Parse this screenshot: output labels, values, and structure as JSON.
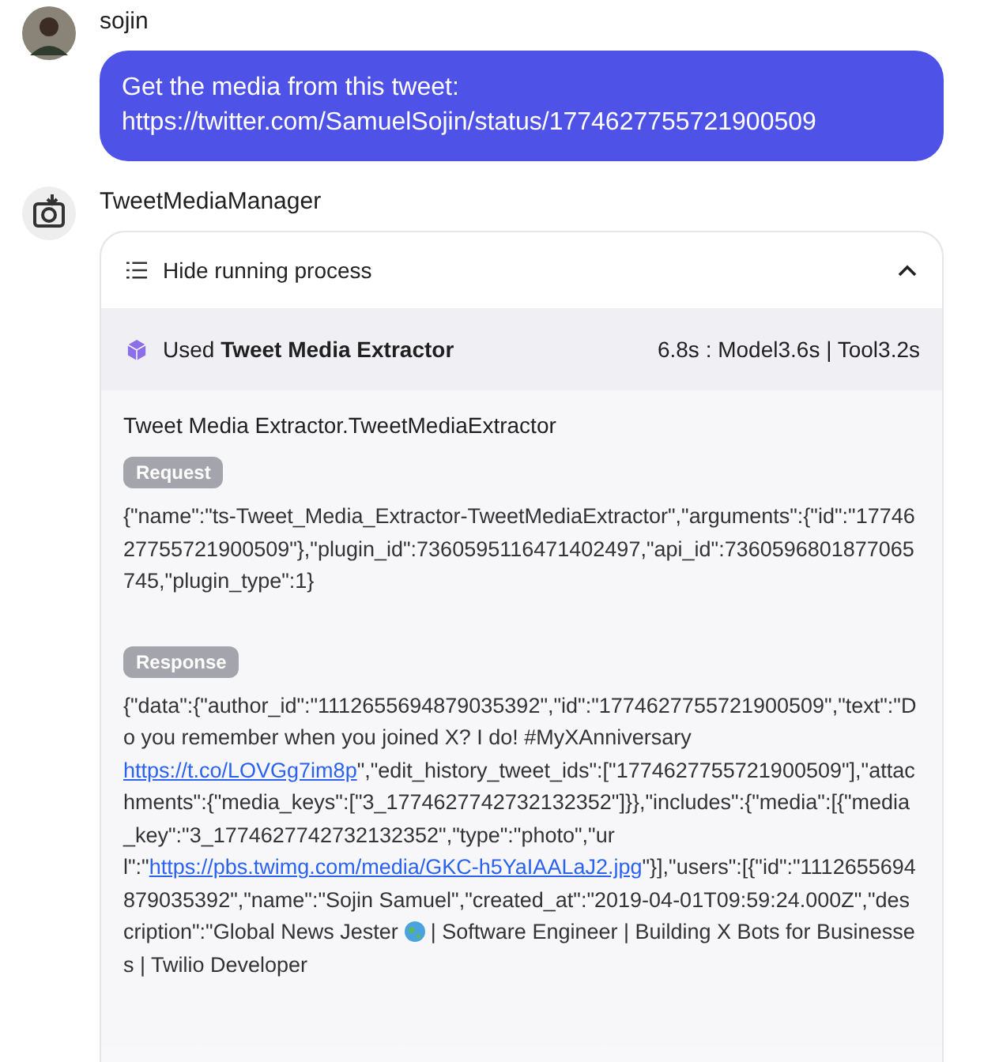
{
  "messages": [
    {
      "kind": "user",
      "sender": "sojin",
      "text": "Get the media from this tweet:\nhttps://twitter.com/SamuelSojin/status/1774627755721900509"
    },
    {
      "kind": "bot",
      "sender": "TweetMediaManager",
      "process": {
        "toggle_label": "Hide running process",
        "expanded": true,
        "used_prefix": "Used",
        "tool_name": "Tweet Media Extractor",
        "timing": "6.8s : Model3.6s | Tool3.2s",
        "call_name": "Tweet Media Extractor.TweetMediaExtractor",
        "request_label": "Request",
        "request": "{\"name\":\"ts-Tweet_Media_Extractor-TweetMediaExtractor\",\"arguments\":{\"id\":\"1774627755721900509\"},\"plugin_id\":7360595116471402497,\"api_id\":7360596801877065745,\"plugin_type\":1}",
        "response_label": "Response",
        "response": [
          {
            "kind": "text",
            "text": "{\"data\":{\"author_id\":\"1112655694879035392\",\"id\":\"1774627755721900509\",\"text\":\"Do you remember when you joined X? I do! #MyXAnniversary "
          },
          {
            "kind": "link",
            "text": "https://t.co/LOVGg7im8p"
          },
          {
            "kind": "text",
            "text": "\",\"edit_history_tweet_ids\":[\"1774627755721900509\"],\"attachments\":{\"media_keys\":[\"3_1774627742732132352\"]}},\"includes\":{\"media\":[{\"media_key\":\"3_1774627742732132352\",\"type\":\"photo\",\"url\":\""
          },
          {
            "kind": "link",
            "text": "https://pbs.twimg.com/media/GKC-h5YaIAALaJ2.jpg"
          },
          {
            "kind": "text",
            "text": "\"}],\"users\":[{\"id\":\"1112655694879035392\",\"name\":\"Sojin Samuel\",\"created_at\":\"2019-04-01T09:59:24.000Z\",\"description\":\"Global News Jester "
          },
          {
            "kind": "globe"
          },
          {
            "kind": "text",
            "text": " | Software Engineer | Building X Bots for Businesses | Twilio Developer"
          }
        ]
      }
    }
  ]
}
